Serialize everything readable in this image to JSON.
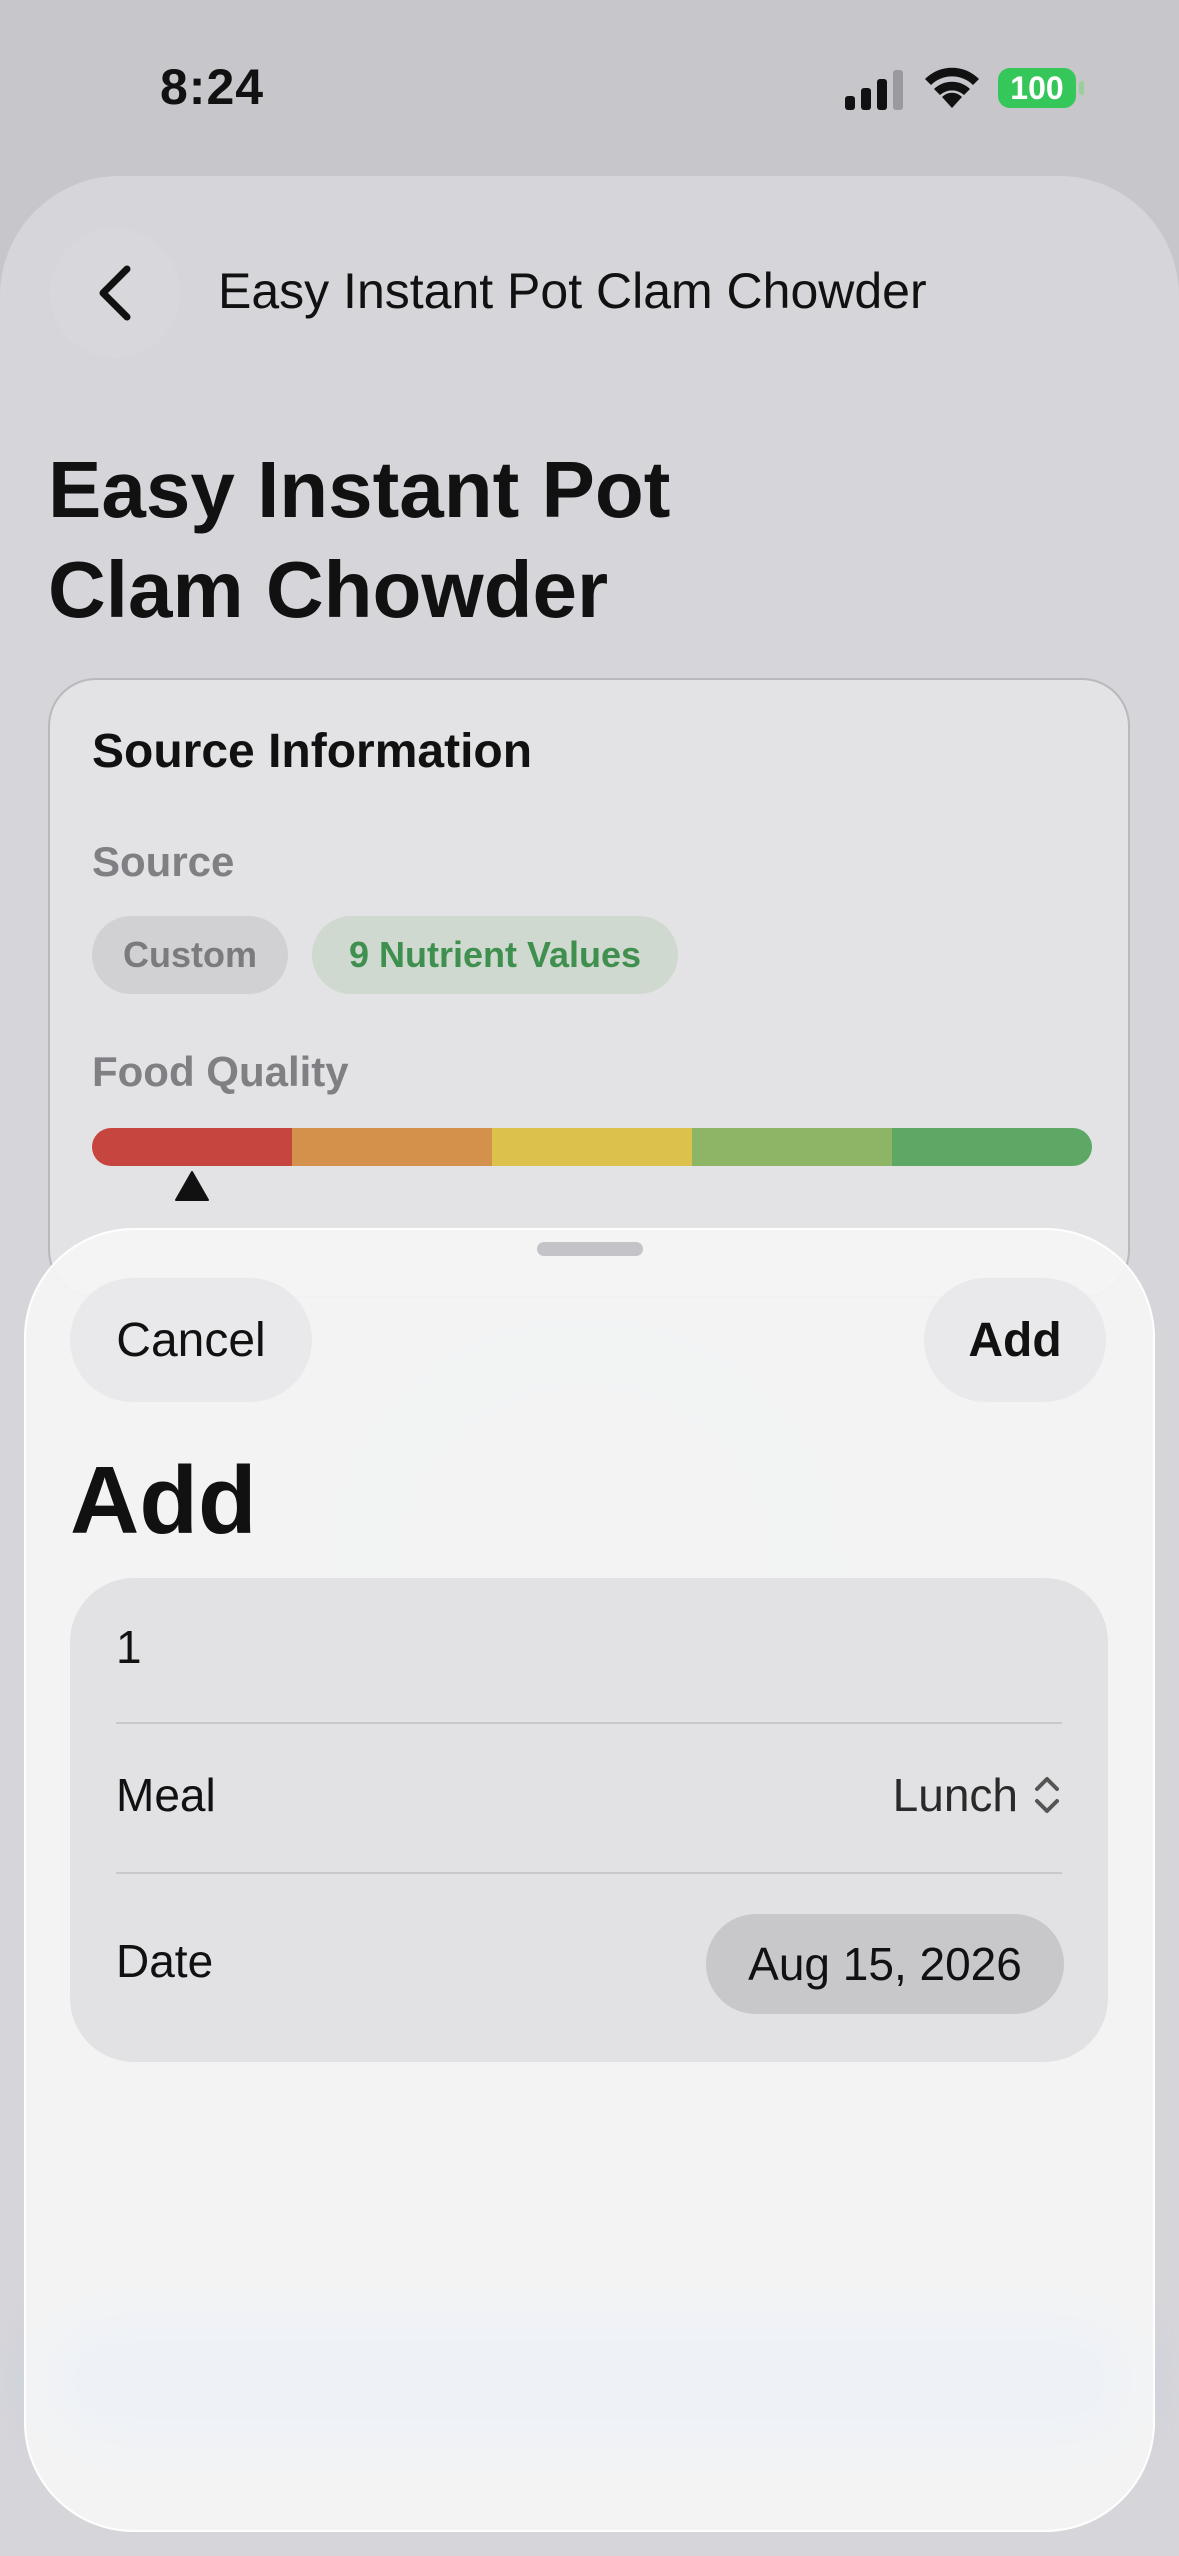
{
  "status": {
    "time": "8:24",
    "battery": "100"
  },
  "nav": {
    "title": "Easy Instant Pot Clam Chowder"
  },
  "page": {
    "title": "Easy Instant Pot Clam Chowder"
  },
  "source_info": {
    "header": "Source Information",
    "source_label": "Source",
    "chips": [
      "Custom",
      "9 Nutrient Values"
    ],
    "food_quality_label": "Food Quality",
    "quality_colors": [
      "#c6453e",
      "#d4914c",
      "#dcc24d",
      "#8db565",
      "#5ca864"
    ],
    "quality_level_fraction": 0.1
  },
  "sheet": {
    "cancel_label": "Cancel",
    "add_label": "Add",
    "title": "Add",
    "quantity_value": "1",
    "meal_label": "Meal",
    "meal_value": "Lunch",
    "date_label": "Date",
    "date_value": "Aug 15, 2026"
  }
}
